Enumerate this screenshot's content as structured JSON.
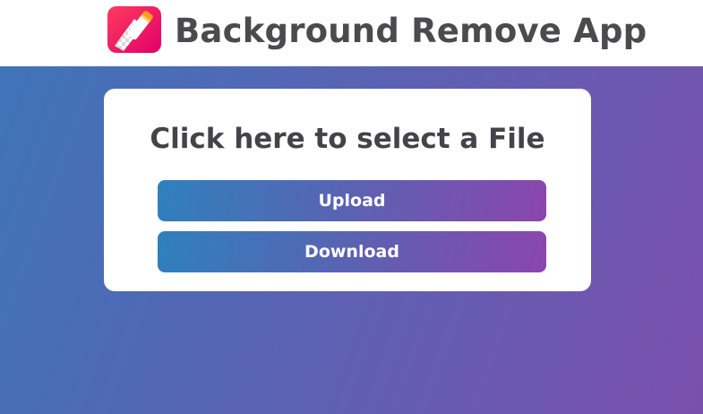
{
  "header": {
    "logo_icon": "eraser-transparency-icon",
    "title": "Background Remove App"
  },
  "card": {
    "heading": "Click here to select a File",
    "upload_label": "Upload",
    "download_label": "Download"
  },
  "colors": {
    "background_gradient": [
      "#3f74b9",
      "#7b50ad"
    ],
    "button_gradient": [
      "#2f80bd",
      "#8b46ad"
    ],
    "logo_gradient": [
      "#ff2d55",
      "#e0006b"
    ],
    "text_dark": "#4a4a4f"
  }
}
